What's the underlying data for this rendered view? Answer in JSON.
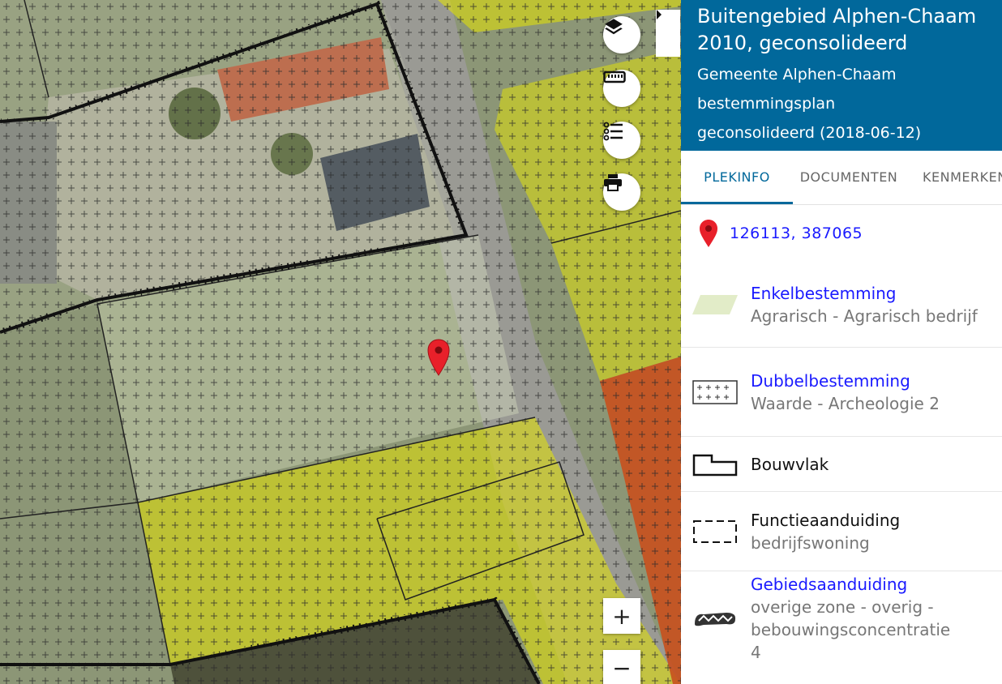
{
  "map": {
    "controls": {
      "layers": "layers-icon",
      "measure": "ruler-icon",
      "legend": "list-icon",
      "print": "printer-icon",
      "zoom_in": "+",
      "zoom_out": "−"
    }
  },
  "panel": {
    "title": "Buitengebied Alphen-Chaam 2010, geconsolideerd",
    "municipality": "Gemeente Alphen-Chaam",
    "plan_type": "bestemmingsplan",
    "status": "geconsolideerd (2018-06-12)",
    "tabs": [
      {
        "label": "PLEKINFO",
        "active": true
      },
      {
        "label": "DOCUMENTEN",
        "active": false
      },
      {
        "label": "KENMERKEN",
        "active": false
      }
    ],
    "coordinates": "126113, 387065",
    "legend": [
      {
        "title": "Enkelbestemming",
        "subtitle": "Agrarisch - Agrarisch bedrijf",
        "symbol": "parallelogram-fill-icon",
        "link": true
      },
      {
        "title": "Dubbelbestemming",
        "subtitle": "Waarde - Archeologie 2",
        "symbol": "crosshatch-box-icon",
        "link": true
      },
      {
        "title": "Bouwvlak",
        "subtitle": "",
        "symbol": "building-outline-icon",
        "link": false
      },
      {
        "title": "Functieaanduiding",
        "subtitle": "bedrijfswoning",
        "symbol": "dashed-box-icon",
        "link": false
      },
      {
        "title": "Gebiedsaanduiding",
        "subtitle": "overige zone - overig - bebouwingsconcentratie 4",
        "symbol": "zigzag-band-icon",
        "link": true
      }
    ]
  },
  "colors": {
    "header_bg": "#01689b",
    "link": "#1a1aff",
    "marker": "#e8202a",
    "agrarisch_fill": "#e2ecc8",
    "wonen_fill": "#e6e600",
    "bedrijf_fill": "#c8501e"
  }
}
